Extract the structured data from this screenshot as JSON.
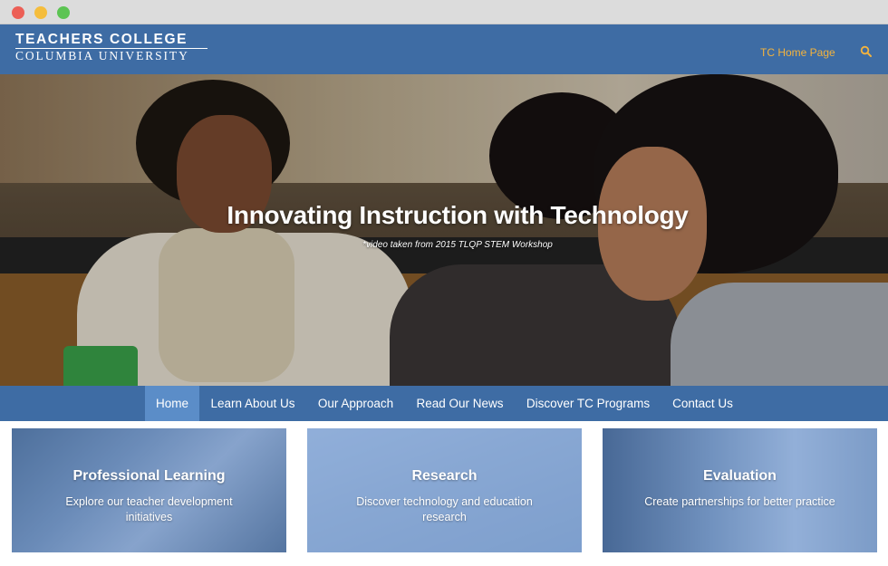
{
  "window": {
    "controls": [
      "close",
      "minimize",
      "maximize"
    ]
  },
  "header": {
    "logo_line1": "TEACHERS COLLEGE",
    "logo_line2": "COLUMBIA UNIVERSITY",
    "home_link": "TC Home Page",
    "search_icon": "search-icon",
    "accent_color": "#f3b33d",
    "brand_color": "#3e6ca4"
  },
  "hero": {
    "title": "Innovating Instruction with Technology",
    "caption": "*video taken from 2015 TLQP STEM Workshop"
  },
  "nav": {
    "items": [
      "Home",
      "Learn About Us",
      "Our Approach",
      "Read Our News",
      "Discover TC Programs",
      "Contact Us"
    ],
    "active": "Home"
  },
  "cards": [
    {
      "title": "Professional Learning",
      "description": "Explore our teacher development initiatives"
    },
    {
      "title": "Research",
      "description": "Discover technology and education research"
    },
    {
      "title": "Evaluation",
      "description": "Create partnerships for better practice"
    }
  ]
}
